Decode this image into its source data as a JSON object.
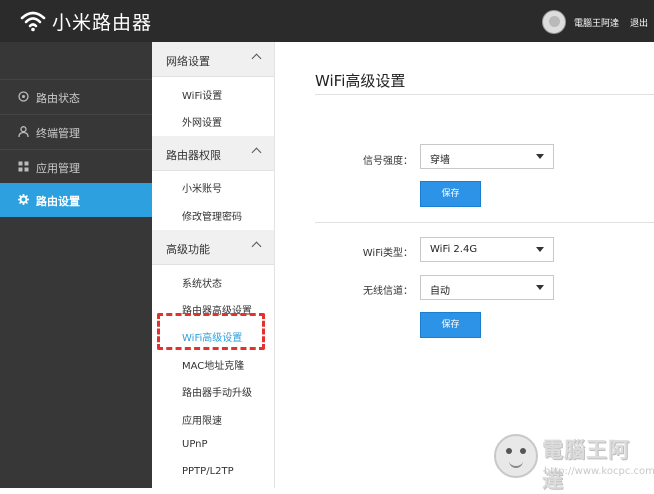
{
  "header": {
    "brand": "小米路由器",
    "username": "電腦王阿達",
    "logout": "退出"
  },
  "sidebar": {
    "items": [
      {
        "label": "路由状态",
        "icon": "gauge-icon",
        "active": false
      },
      {
        "label": "终端管理",
        "icon": "user-icon",
        "active": false
      },
      {
        "label": "应用管理",
        "icon": "grid-icon",
        "active": false
      },
      {
        "label": "路由设置",
        "icon": "gear-icon",
        "active": true
      }
    ]
  },
  "subnav": {
    "sections": [
      {
        "title": "网络设置",
        "items": [
          "WiFi设置",
          "外网设置"
        ]
      },
      {
        "title": "路由器权限",
        "items": [
          "小米账号",
          "修改管理密码"
        ]
      },
      {
        "title": "高级功能",
        "items": [
          "系统状态",
          "路由器高级设置",
          "WiFi高级设置",
          "MAC地址克隆",
          "路由器手动升级",
          "应用限速",
          "UPnP",
          "PPTP/L2TP"
        ]
      }
    ],
    "current": "WiFi高级设置"
  },
  "main": {
    "title": "WiFi高级设置",
    "signal": {
      "label": "信号强度：",
      "value": "穿墙",
      "save": "保存"
    },
    "wifi_type": {
      "label": "WiFi类型：",
      "value": "WiFi 2.4G"
    },
    "channel": {
      "label": "无线信道：",
      "value": "自动",
      "save": "保存"
    }
  },
  "watermark": {
    "title": "電腦王阿達",
    "url": "http://www.kocpc.com.tw"
  },
  "colors": {
    "accent": "#2da0df",
    "button": "#2d93e6",
    "topbar": "#2b2b2b",
    "sidebar": "#373737",
    "highlight": "#e53030"
  }
}
